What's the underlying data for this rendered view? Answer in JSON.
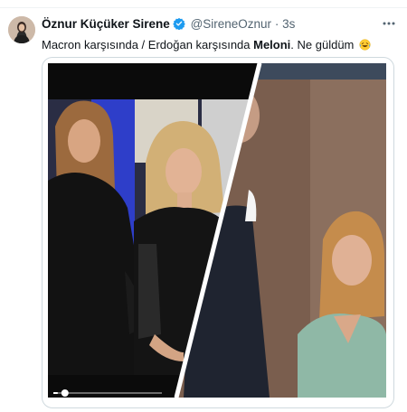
{
  "tweet": {
    "author_name": "Öznur Küçüker Sirene",
    "handle": "@SireneOznur",
    "separator": "·",
    "time": "3s",
    "text_part1": "Macron karşısında / Erdoğan karşısında ",
    "text_bold": "Meloni",
    "text_part2": ". Ne güldüm",
    "emoji": "laughing-with-tears-emoji"
  },
  "media": {
    "type": "video",
    "panels": [
      "left-photo",
      "right-photo"
    ],
    "progress": 0.04
  },
  "colors": {
    "verified": "#1d9bf0",
    "text": "#0f1419",
    "secondary": "#536471",
    "border": "#cfd9de"
  }
}
